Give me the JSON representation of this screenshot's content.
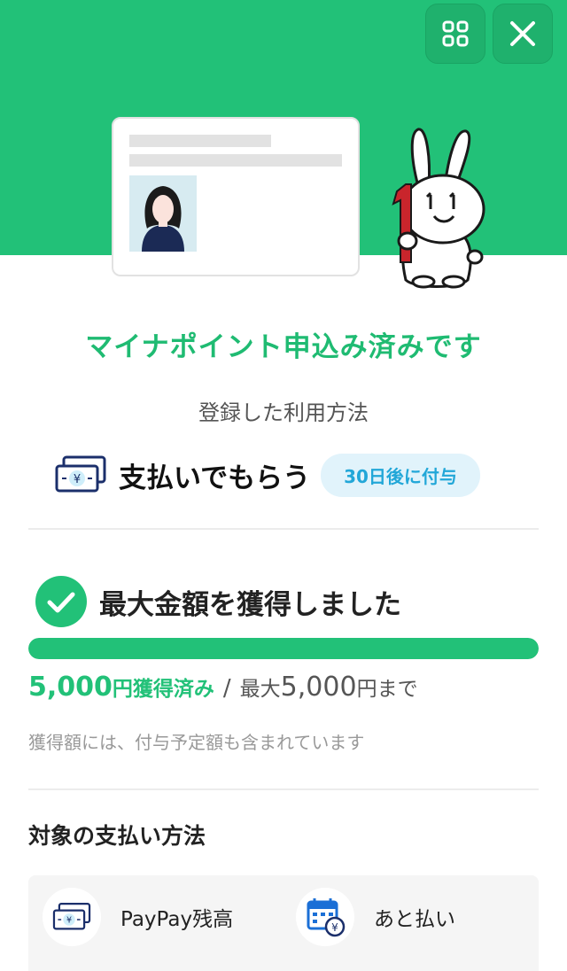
{
  "header": {
    "grid_icon": "grid-icon",
    "close_icon": "close-icon",
    "background_color": "#22c178"
  },
  "illustration": {
    "card_icon": "id-card-illustration",
    "mascot_icon": "rabbit-mascot-illustration"
  },
  "status": {
    "headline": "マイナポイント申込み済みです",
    "registered_label": "登録した利用方法",
    "method_label": "支払いでもらう",
    "method_icon": "yen-bill-icon",
    "badge": "30日後に付与"
  },
  "progress": {
    "title": "最大金額を獲得しました",
    "check_icon": "check-circle-icon",
    "fraction": 1.0,
    "earned_amount": "5,000",
    "earned_suffix": "円獲得済み",
    "separator": "/",
    "max_prefix": "最大",
    "max_amount": "5,000",
    "max_suffix": "円まで",
    "note": "獲得額には、付与予定額も含まれています"
  },
  "payment_methods": {
    "title": "対象の支払い方法",
    "items": [
      {
        "label": "PayPay残高",
        "icon": "yen-bill-icon"
      },
      {
        "label": "あと払い",
        "icon": "calendar-yen-icon"
      }
    ]
  },
  "colors": {
    "accent": "#22c178",
    "badge_bg": "#e1f3fb",
    "badge_text": "#22a7d8"
  }
}
